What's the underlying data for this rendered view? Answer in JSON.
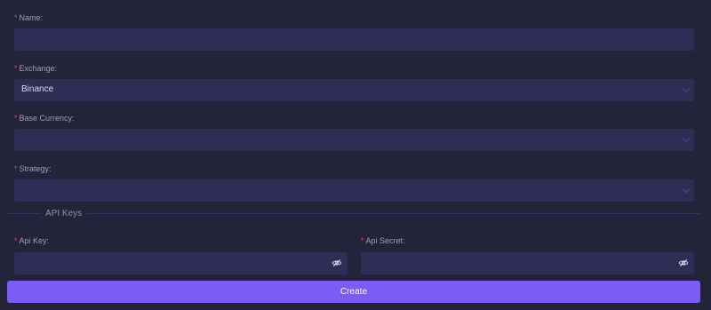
{
  "form": {
    "name": {
      "label": "Name:",
      "value": ""
    },
    "exchange": {
      "label": "Exchange:",
      "value": "Binance"
    },
    "base_currency": {
      "label": "Base Currency:",
      "value": ""
    },
    "strategy": {
      "label": "Strategy:",
      "value": ""
    },
    "api_keys_section": "API Keys",
    "api_key": {
      "label": "Api Key:",
      "value": ""
    },
    "api_secret": {
      "label": "Api Secret:",
      "value": ""
    },
    "create_label": "Create",
    "required_mark": "*",
    "colors": {
      "accent": "#7b5cf6",
      "required": "#e5484d",
      "field_bg": "#2d2d55",
      "page_bg": "#23243a"
    },
    "icons": {
      "select": "chevron-down-icon",
      "password": "eye-off-icon"
    }
  }
}
